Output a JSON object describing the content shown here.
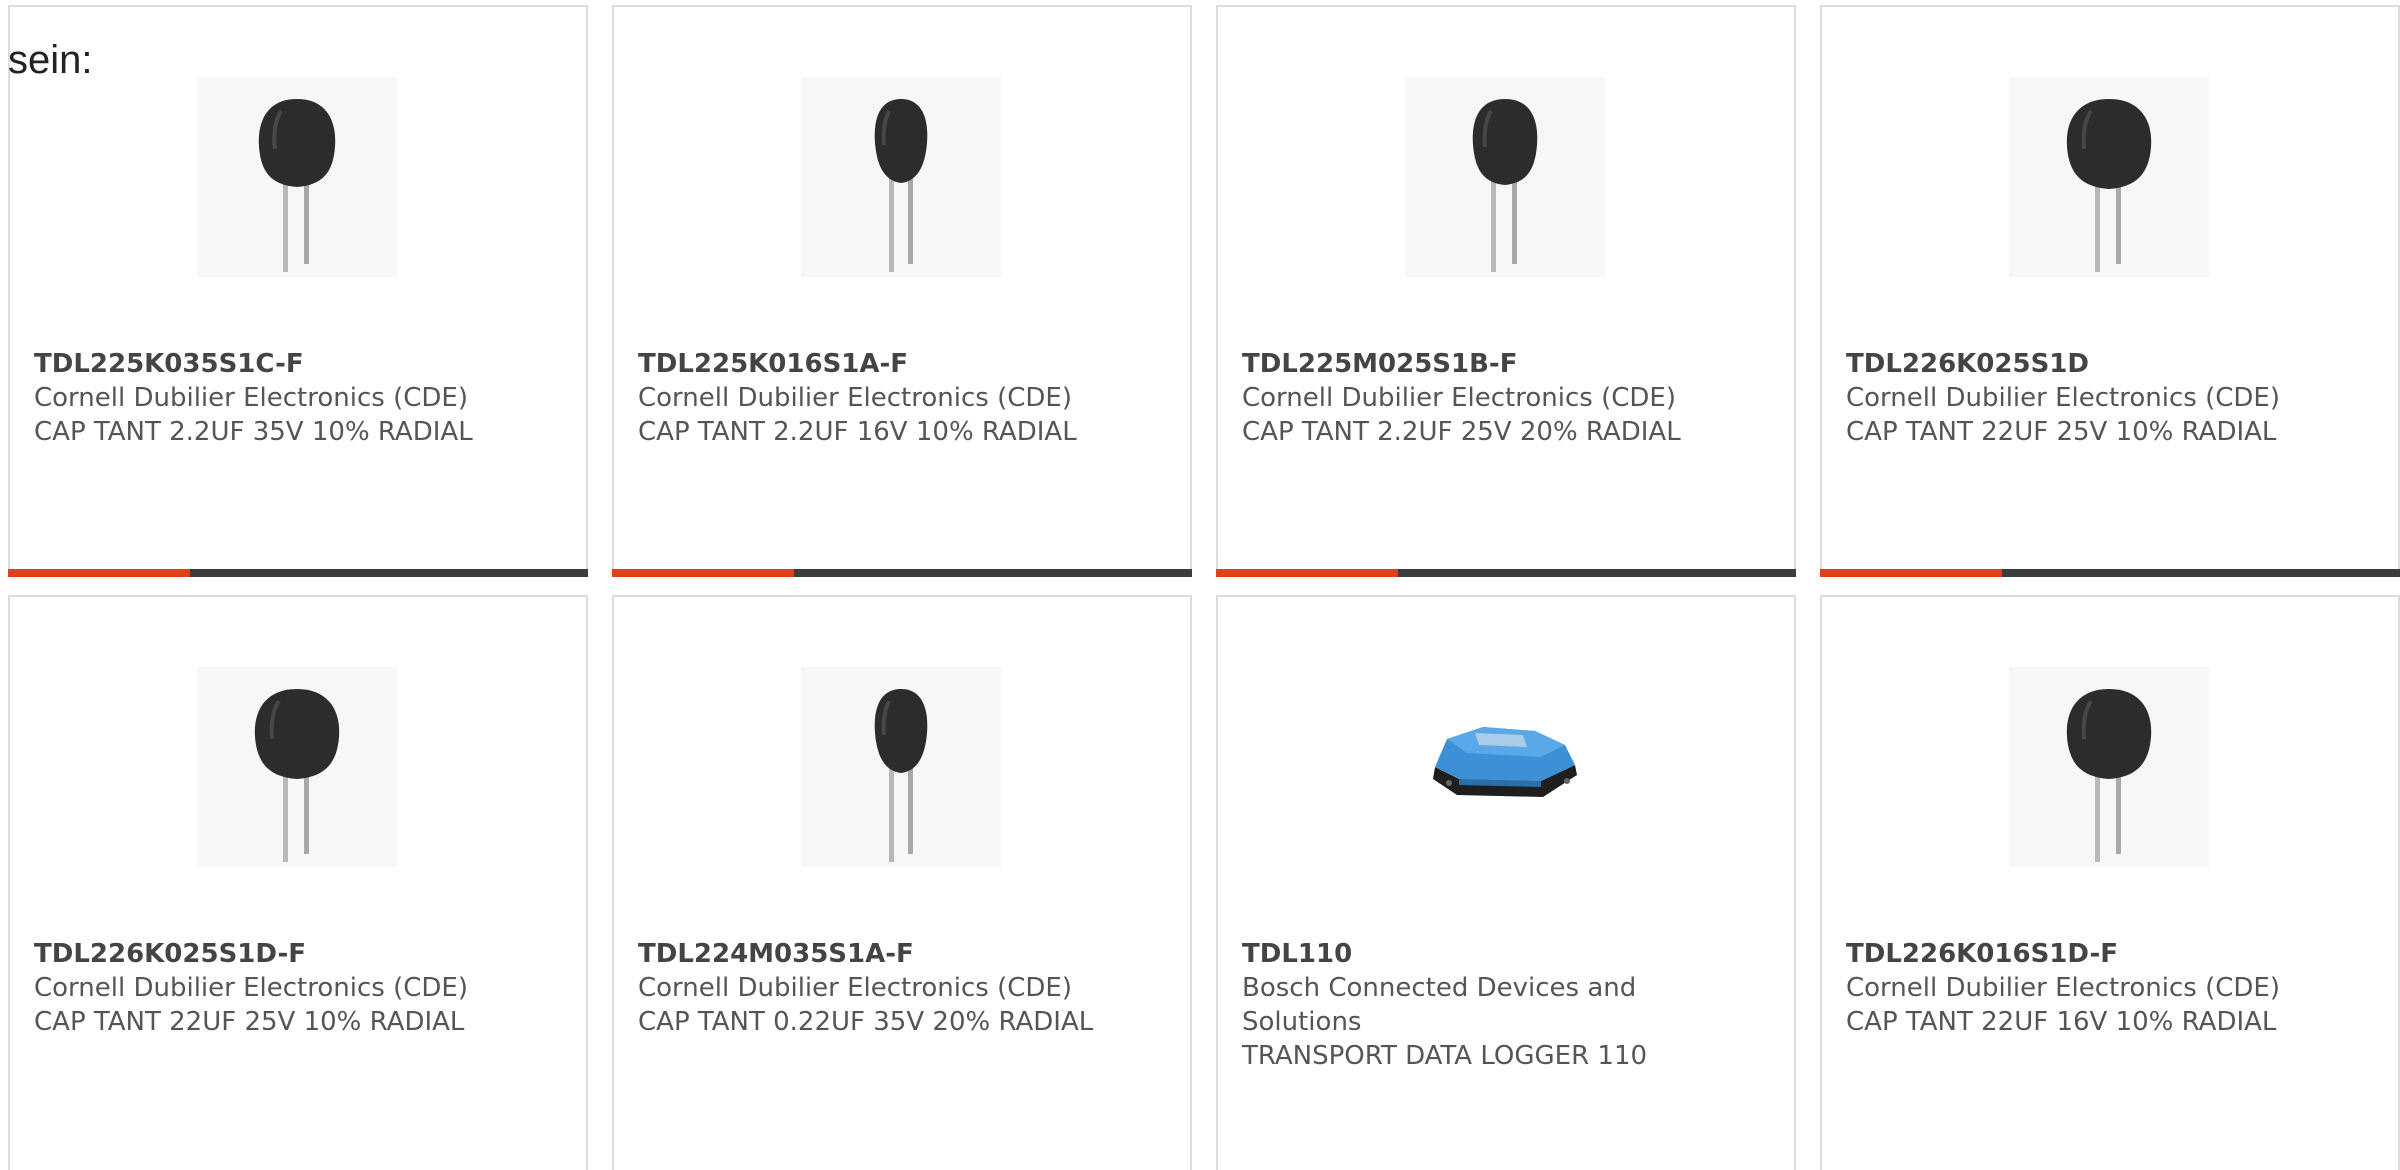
{
  "intro_text": "sein:",
  "colors": {
    "accent": "#e0401c",
    "bar_dark": "#3d3d3d",
    "border": "#dcdcdc"
  },
  "products": [
    {
      "part_number": "TDL225K035S1C-F",
      "manufacturer": "Cornell Dubilier Electronics (CDE)",
      "description": "CAP TANT 2.2UF 35V 10% RADIAL",
      "image": "tantalum-capacitor-icon"
    },
    {
      "part_number": "TDL225K016S1A-F",
      "manufacturer": "Cornell Dubilier Electronics (CDE)",
      "description": "CAP TANT 2.2UF 16V 10% RADIAL",
      "image": "tantalum-capacitor-icon"
    },
    {
      "part_number": "TDL225M025S1B-F",
      "manufacturer": "Cornell Dubilier Electronics (CDE)",
      "description": "CAP TANT 2.2UF 25V 20% RADIAL",
      "image": "tantalum-capacitor-icon"
    },
    {
      "part_number": "TDL226K025S1D",
      "manufacturer": "Cornell Dubilier Electronics (CDE)",
      "description": "CAP TANT 22UF 25V 10% RADIAL",
      "image": "tantalum-capacitor-icon"
    },
    {
      "part_number": "TDL226K025S1D-F",
      "manufacturer": "Cornell Dubilier Electronics (CDE)",
      "description": "CAP TANT 22UF 25V 10% RADIAL",
      "image": "tantalum-capacitor-icon"
    },
    {
      "part_number": "TDL224M035S1A-F",
      "manufacturer": "Cornell Dubilier Electronics (CDE)",
      "description": "CAP TANT 0.22UF 35V 20% RADIAL",
      "image": "tantalum-capacitor-icon"
    },
    {
      "part_number": "TDL110",
      "manufacturer": "Bosch Connected Devices and Solutions",
      "description": "TRANSPORT DATA LOGGER 110",
      "image": "data-logger-icon"
    },
    {
      "part_number": "TDL226K016S1D-F",
      "manufacturer": "Cornell Dubilier Electronics (CDE)",
      "description": "CAP TANT 22UF 16V 10% RADIAL",
      "image": "tantalum-capacitor-icon"
    }
  ]
}
